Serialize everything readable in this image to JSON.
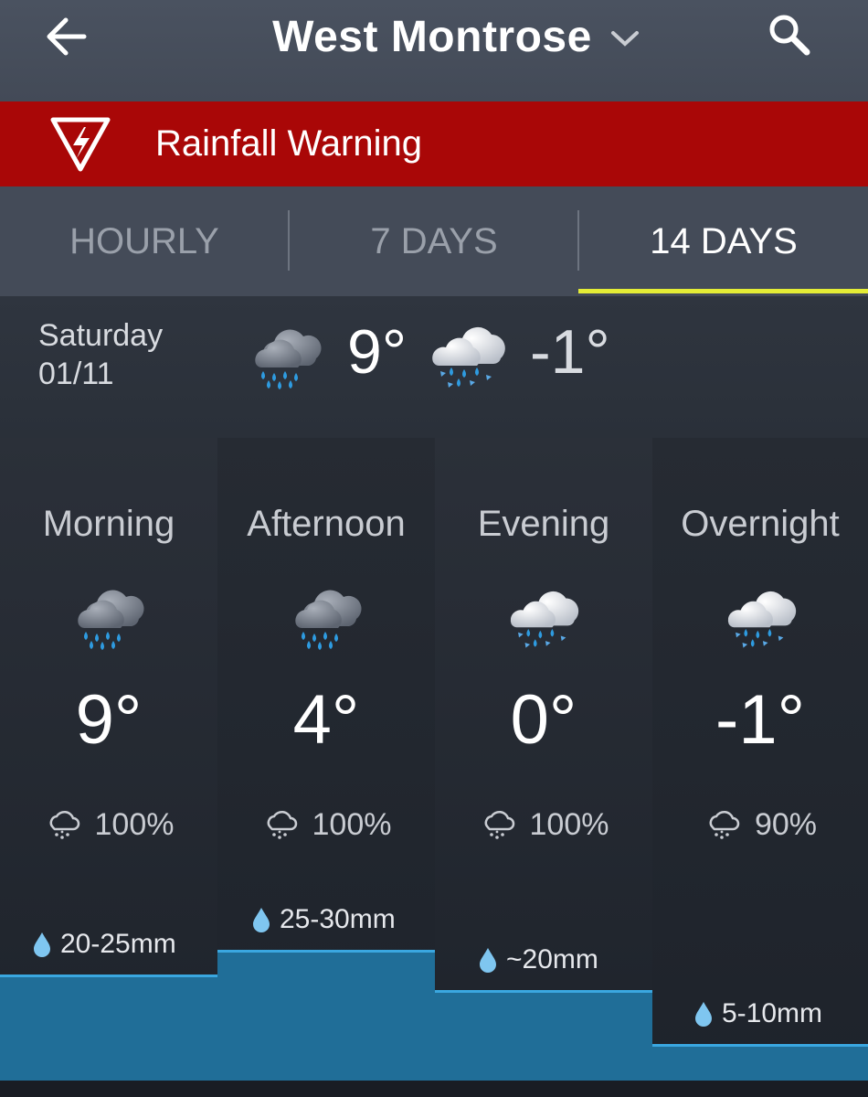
{
  "header": {
    "title": "West Montrose"
  },
  "warning": {
    "text": "Rainfall Warning"
  },
  "tabs": [
    {
      "label": "HOURLY",
      "active": false
    },
    {
      "label": "7 DAYS",
      "active": false
    },
    {
      "label": "14 DAYS",
      "active": true
    }
  ],
  "day": {
    "name": "Saturday",
    "date": "01/11",
    "high": "9°",
    "low": "-1°",
    "high_icon": "rain-cloud-icon",
    "low_icon": "rain-snow-cloud-icon"
  },
  "periods": [
    {
      "label": "Morning",
      "temp": "9°",
      "pop": "100%",
      "rain": "20-25mm",
      "icon": "rain-cloud-icon",
      "rain_level": 0.55
    },
    {
      "label": "Afternoon",
      "temp": "4°",
      "pop": "100%",
      "rain": "25-30mm",
      "icon": "rain-cloud-icon",
      "rain_level": 0.68
    },
    {
      "label": "Evening",
      "temp": "0°",
      "pop": "100%",
      "rain": "~20mm",
      "icon": "rain-snow-cloud-icon",
      "rain_level": 0.47
    },
    {
      "label": "Overnight",
      "temp": "-1°",
      "pop": "90%",
      "rain": "5-10mm",
      "icon": "rain-snow-cloud-icon",
      "rain_level": 0.19
    }
  ],
  "colors": {
    "warning": "#a90707",
    "tab_active_underline": "#e4ec36",
    "rain_bar": "#206e98",
    "rain_bar_edge": "#3aa7e0"
  }
}
